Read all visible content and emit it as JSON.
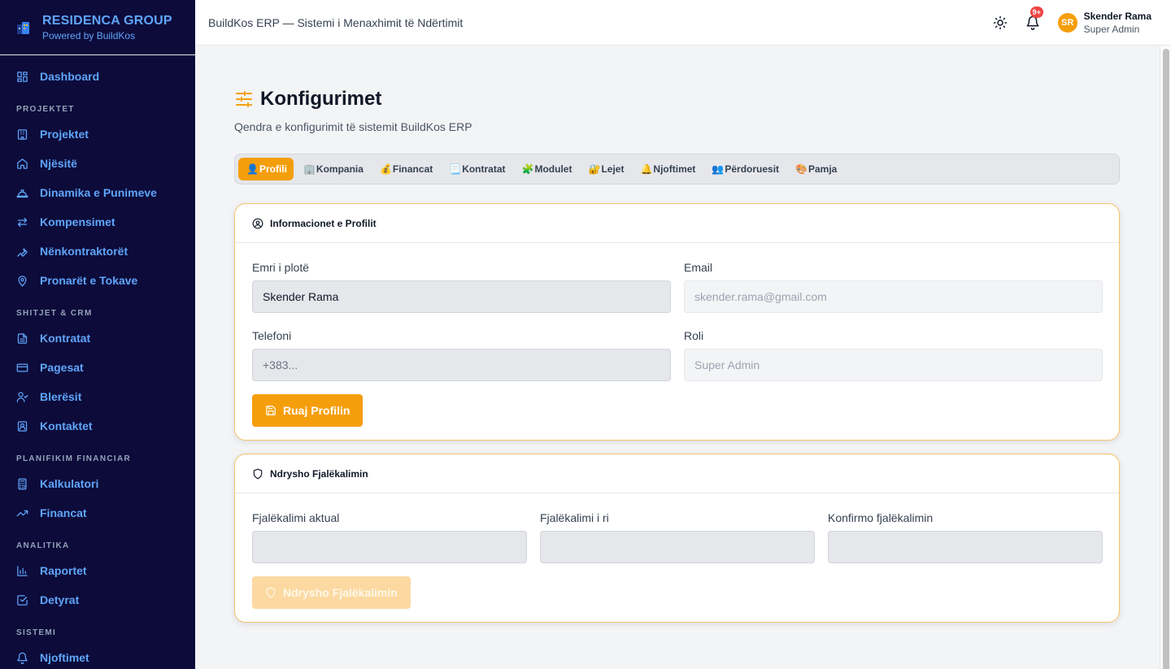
{
  "brand": {
    "name": "RESIDENCA GROUP",
    "powered": "Powered by BuildKos"
  },
  "sidebar": {
    "dashboard": "Dashboard",
    "sections": [
      {
        "title": "PROJEKTET",
        "items": [
          "Projektet",
          "Njësitë",
          "Dinamika e Punimeve",
          "Kompensimet",
          "Nënkontraktorët",
          "Pronarët e Tokave"
        ]
      },
      {
        "title": "SHITJET & CRM",
        "items": [
          "Kontratat",
          "Pagesat",
          "Blerësit",
          "Kontaktet"
        ]
      },
      {
        "title": "PLANIFIKIM FINANCIAR",
        "items": [
          "Kalkulatori",
          "Financat"
        ]
      },
      {
        "title": "ANALITIKA",
        "items": [
          "Raportet",
          "Detyrat"
        ]
      },
      {
        "title": "SISTEMI",
        "items": [
          "Njoftimet"
        ]
      }
    ]
  },
  "header": {
    "title": "BuildKos ERP — Sistemi i Menaxhimit të Ndërtimit",
    "notif_count": "9+",
    "user": {
      "initials": "SR",
      "name": "Skender Rama",
      "role": "Super Admin"
    }
  },
  "page": {
    "title": "Konfigurimet",
    "subtitle": "Qendra e konfigurimit të sistemit BuildKos ERP",
    "tabs": [
      {
        "icon": "👤",
        "label": "Profili"
      },
      {
        "icon": "🏢",
        "label": "Kompania"
      },
      {
        "icon": "💰",
        "label": "Financat"
      },
      {
        "icon": "📃",
        "label": "Kontratat"
      },
      {
        "icon": "🧩",
        "label": "Modulet"
      },
      {
        "icon": "🔐",
        "label": "Lejet"
      },
      {
        "icon": "🔔",
        "label": "Njoftimet"
      },
      {
        "icon": "👥",
        "label": "Përdoruesit"
      },
      {
        "icon": "🎨",
        "label": "Pamja"
      }
    ],
    "active_tab": "Profili"
  },
  "profile_card": {
    "title": "Informacionet e Profilit",
    "fullname_label": "Emri i plotë",
    "fullname_value": "Skender Rama",
    "email_label": "Email",
    "email_value": "skender.rama@gmail.com",
    "phone_label": "Telefoni",
    "phone_placeholder": "+383...",
    "role_label": "Roli",
    "role_value": "Super Admin",
    "save_label": "Ruaj Profilin"
  },
  "password_card": {
    "title": "Ndrysho Fjalëkalimin",
    "current_label": "Fjalëkalimi aktual",
    "new_label": "Fjalëkalimi i ri",
    "confirm_label": "Konfirmo fjalëkalimin",
    "submit_label": "Ndrysho Fjalëkalimin"
  },
  "colors": {
    "accent": "#f59e0b",
    "sidebar_bg": "#0c0b3a",
    "sidebar_text": "#60a5fa"
  },
  "icons": [
    "layout-grid-icon",
    "building-icon",
    "home-icon",
    "hard-hat-icon",
    "arrows-icon",
    "wrench-icon",
    "map-pin-icon",
    "file-icon",
    "credit-card-icon",
    "user-check-icon",
    "contact-icon",
    "calculator-icon",
    "trending-up-icon",
    "bar-chart-icon",
    "check-square-icon",
    "bell-icon",
    "sun-icon",
    "sliders-icon",
    "user-circle-icon",
    "save-icon",
    "shield-icon"
  ]
}
